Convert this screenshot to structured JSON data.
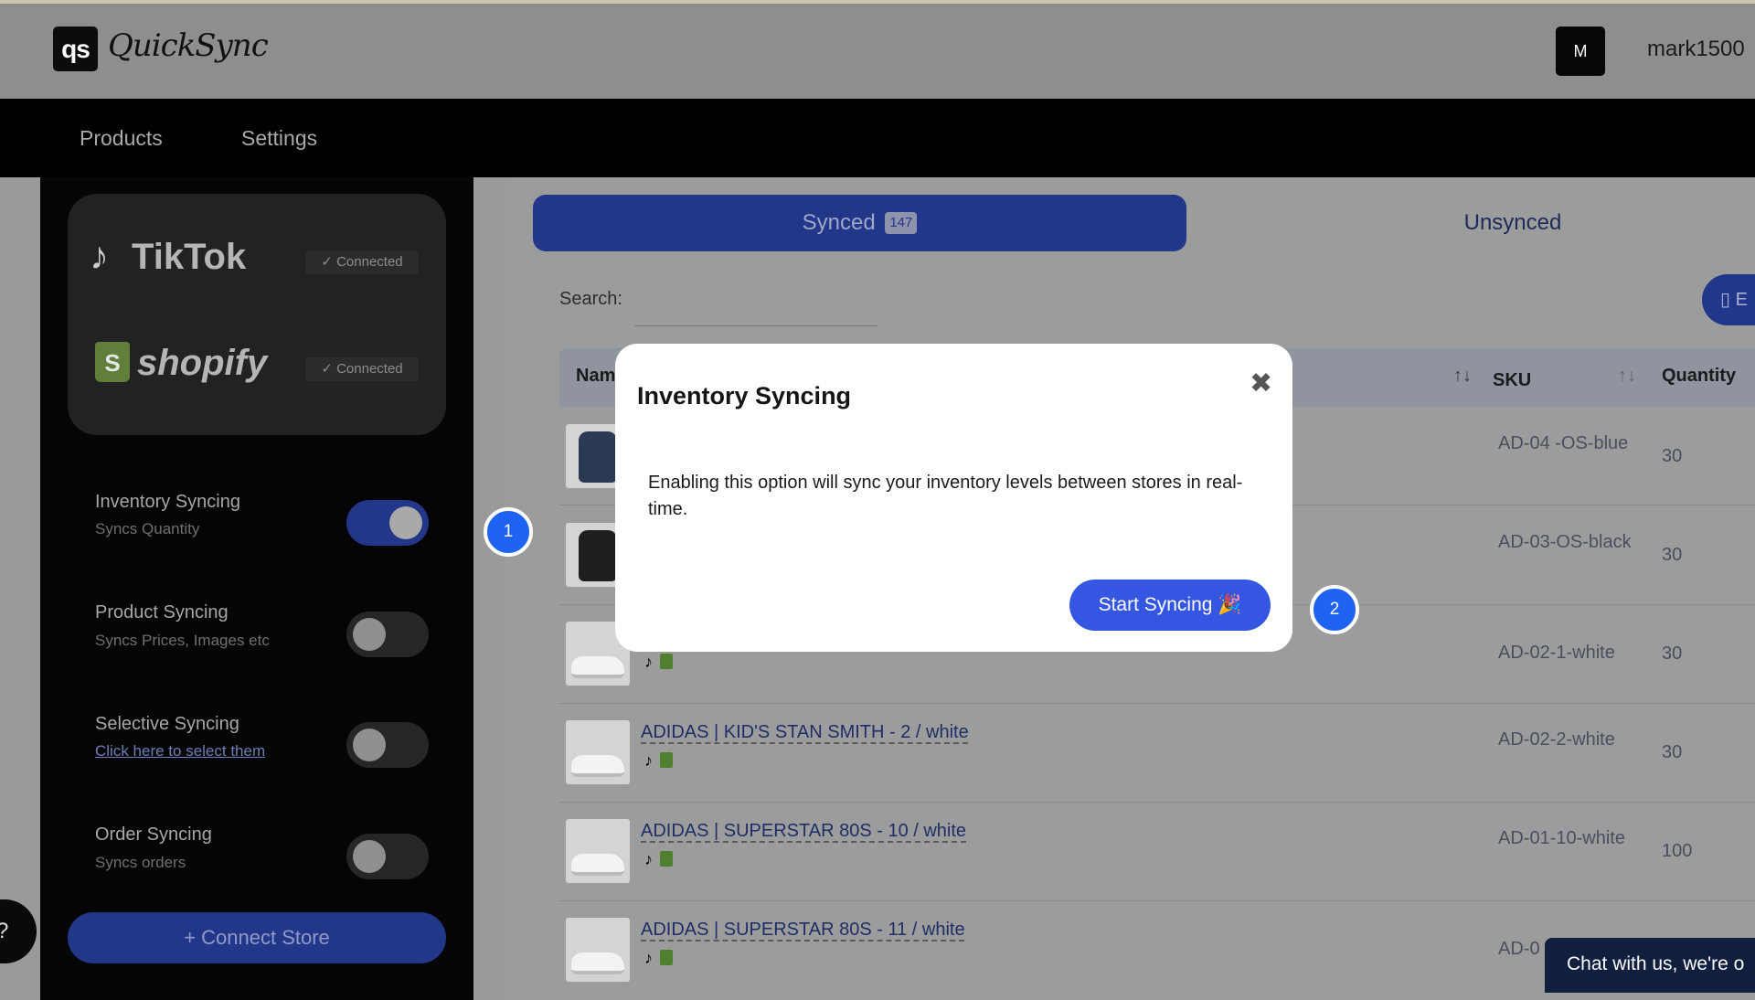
{
  "header": {
    "logo_mark": "qs",
    "app_name": "QuickSync",
    "avatar_letter": "M",
    "username": "mark1500"
  },
  "nav": {
    "products": "Products",
    "settings": "Settings"
  },
  "stores": {
    "tiktok_name": "TikTok",
    "tiktok_status": "✓ Connected",
    "shopify_name": "shopify",
    "shopify_status": "✓ Connected"
  },
  "options": [
    {
      "title": "Inventory Syncing",
      "subtitle": "Syncs Quantity",
      "enabled": true
    },
    {
      "title": "Product Syncing",
      "subtitle": "Syncs Prices, Images etc",
      "enabled": false
    },
    {
      "title": "Selective Syncing",
      "subtitle": "Click here to select them",
      "enabled": false
    },
    {
      "title": "Order Syncing",
      "subtitle": "Syncs orders",
      "enabled": false
    }
  ],
  "connect_store": "+  Connect Store",
  "help": "?",
  "tabs": {
    "synced_label": "Synced",
    "synced_count": "147",
    "unsynced_label": "Unsynced"
  },
  "export_label": "E",
  "search": {
    "label": "Search:",
    "value": ""
  },
  "table": {
    "headers": {
      "name": "Nam",
      "sku": "SKU",
      "quantity": "Quantity"
    },
    "rows": [
      {
        "name": "",
        "sku": "AD-04 -OS-blue",
        "qty": "30"
      },
      {
        "name": "",
        "sku": "AD-03-OS-black",
        "qty": "30"
      },
      {
        "name": "",
        "sku": "AD-02-1-white",
        "qty": "30"
      },
      {
        "name": "ADIDAS | KID'S STAN SMITH - 2 / white",
        "sku": "AD-02-2-white",
        "qty": "30"
      },
      {
        "name": "ADIDAS | SUPERSTAR 80S - 10 / white",
        "sku": "AD-01-10-white",
        "qty": "100"
      },
      {
        "name": "ADIDAS | SUPERSTAR 80S - 11 / white",
        "sku": "AD-0",
        "qty": ""
      }
    ]
  },
  "chat": "Chat with us, we're o",
  "modal": {
    "title": "Inventory Syncing",
    "body": "Enabling this option will sync your inventory levels between stores in real-time.",
    "button": "Start Syncing 🎉"
  },
  "markers": {
    "one": "1",
    "two": "2"
  },
  "colors": {
    "accent": "#22368a",
    "modal_button": "#3556e3",
    "marker": "#1f63f2"
  }
}
